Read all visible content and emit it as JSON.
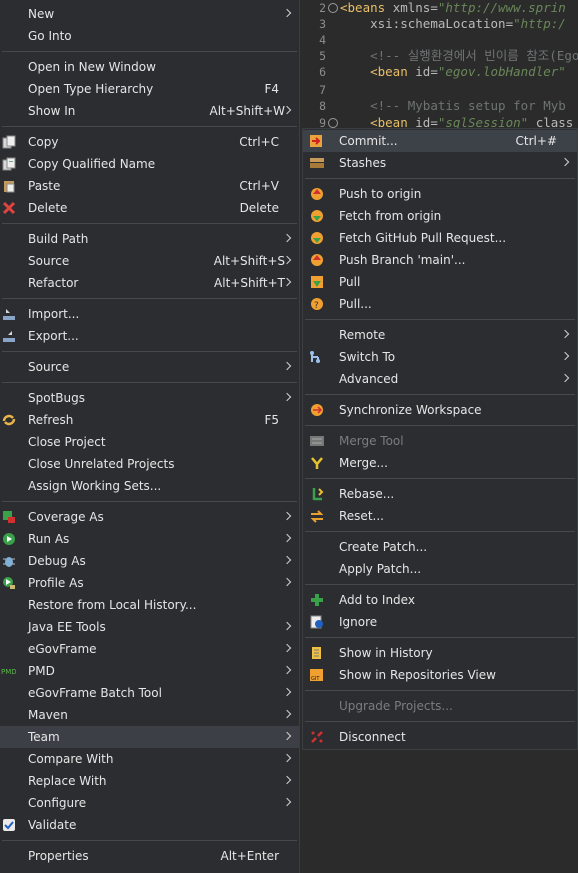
{
  "editor": {
    "lines": [
      {
        "num": "2",
        "fold": true,
        "html": "<span class='tag'>&lt;beans</span> <span class='attr'>xmlns=</span><span class='str'>\"http://www.sprin</span>"
      },
      {
        "num": "3",
        "html": "&nbsp;&nbsp;&nbsp;&nbsp;<span class='attr'>xsi:schemaLocation=</span><span class='str'>\"http:/</span>"
      },
      {
        "num": "4",
        "html": ""
      },
      {
        "num": "5",
        "html": "&nbsp;&nbsp;&nbsp;&nbsp;<span class='cmt'>&lt;!-- 실행환경에서 빈이름 참조(EgovAb</span>"
      },
      {
        "num": "6",
        "html": "&nbsp;&nbsp;&nbsp;&nbsp;<span class='tag'>&lt;bean</span> <span class='attr'>id=</span><span class='str'>\"egov.lobHandler\"</span>"
      },
      {
        "num": "7",
        "html": ""
      },
      {
        "num": "8",
        "html": "&nbsp;&nbsp;&nbsp;&nbsp;<span class='cmt'>&lt;!-- Mybatis setup for Myb</span>"
      },
      {
        "num": "9",
        "fold": true,
        "html": "&nbsp;&nbsp;&nbsp;&nbsp;<span class='tag'>&lt;bean</span> <span class='attr'>id=</span><span class='str'>\"sqlSession\"</span> <span class='attr'>class</span>"
      }
    ]
  },
  "menu": {
    "items": [
      {
        "label": "New",
        "arrow": true
      },
      {
        "label": "Go Into"
      },
      {
        "sep": true
      },
      {
        "label": "Open in New Window"
      },
      {
        "label": "Open Type Hierarchy",
        "shortcut": "F4"
      },
      {
        "label": "Show In",
        "shortcut": "Alt+Shift+W",
        "arrow": true
      },
      {
        "sep": true
      },
      {
        "label": "Copy",
        "shortcut": "Ctrl+C",
        "icon": "copy-icon"
      },
      {
        "label": "Copy Qualified Name",
        "icon": "copy-qualified-icon"
      },
      {
        "label": "Paste",
        "shortcut": "Ctrl+V",
        "icon": "paste-icon"
      },
      {
        "label": "Delete",
        "shortcut": "Delete",
        "icon": "delete-icon"
      },
      {
        "sep": true
      },
      {
        "label": "Build Path",
        "arrow": true
      },
      {
        "label": "Source",
        "shortcut": "Alt+Shift+S",
        "arrow": true
      },
      {
        "label": "Refactor",
        "shortcut": "Alt+Shift+T",
        "arrow": true
      },
      {
        "sep": true
      },
      {
        "label": "Import...",
        "icon": "import-icon"
      },
      {
        "label": "Export...",
        "icon": "export-icon"
      },
      {
        "sep": true
      },
      {
        "label": "Source",
        "arrow": true
      },
      {
        "sep": true
      },
      {
        "label": "SpotBugs",
        "arrow": true
      },
      {
        "label": "Refresh",
        "shortcut": "F5",
        "icon": "refresh-icon"
      },
      {
        "label": "Close Project"
      },
      {
        "label": "Close Unrelated Projects"
      },
      {
        "label": "Assign Working Sets..."
      },
      {
        "sep": true
      },
      {
        "label": "Coverage As",
        "arrow": true,
        "icon": "coverage-icon"
      },
      {
        "label": "Run As",
        "arrow": true,
        "icon": "run-icon"
      },
      {
        "label": "Debug As",
        "arrow": true,
        "icon": "debug-icon"
      },
      {
        "label": "Profile As",
        "arrow": true,
        "icon": "profile-icon"
      },
      {
        "label": "Restore from Local History..."
      },
      {
        "label": "Java EE Tools",
        "arrow": true
      },
      {
        "label": "eGovFrame",
        "arrow": true
      },
      {
        "label": "PMD",
        "arrow": true,
        "icon": "pmd-icon"
      },
      {
        "label": "eGovFrame Batch Tool",
        "arrow": true
      },
      {
        "label": "Maven",
        "arrow": true
      },
      {
        "label": "Team",
        "arrow": true,
        "highlight": true
      },
      {
        "label": "Compare With",
        "arrow": true
      },
      {
        "label": "Replace With",
        "arrow": true
      },
      {
        "label": "Configure",
        "arrow": true
      },
      {
        "label": "Validate",
        "icon": "checkbox-checked-icon"
      },
      {
        "sep": true
      },
      {
        "label": "Properties",
        "shortcut": "Alt+Enter"
      }
    ]
  },
  "team_menu": {
    "items": [
      {
        "label": "Commit...",
        "shortcut": "Ctrl+#",
        "icon": "commit-icon",
        "highlight": true
      },
      {
        "label": "Stashes",
        "arrow": true,
        "icon": "stashes-icon"
      },
      {
        "sep": true
      },
      {
        "label": "Push to origin",
        "icon": "push-icon"
      },
      {
        "label": "Fetch from origin",
        "icon": "fetch-icon"
      },
      {
        "label": "Fetch GitHub Pull Request...",
        "icon": "fetch-pr-icon"
      },
      {
        "label": "Push Branch 'main'...",
        "icon": "push-branch-icon"
      },
      {
        "label": "Pull",
        "icon": "pull-icon"
      },
      {
        "label": "Pull...",
        "icon": "pull-dialog-icon"
      },
      {
        "sep": true
      },
      {
        "label": "Remote",
        "arrow": true
      },
      {
        "label": "Switch To",
        "arrow": true,
        "icon": "switch-to-icon"
      },
      {
        "label": "Advanced",
        "arrow": true
      },
      {
        "sep": true
      },
      {
        "label": "Synchronize Workspace",
        "icon": "synchronize-icon"
      },
      {
        "sep": true
      },
      {
        "label": "Merge Tool",
        "icon": "merge-tool-icon",
        "disabled": true
      },
      {
        "label": "Merge...",
        "icon": "merge-icon"
      },
      {
        "sep": true
      },
      {
        "label": "Rebase...",
        "icon": "rebase-icon"
      },
      {
        "label": "Reset...",
        "icon": "reset-icon"
      },
      {
        "sep": true
      },
      {
        "label": "Create Patch..."
      },
      {
        "label": "Apply Patch..."
      },
      {
        "sep": true
      },
      {
        "label": "Add to Index",
        "icon": "add-to-index-icon"
      },
      {
        "label": "Ignore",
        "icon": "ignore-icon"
      },
      {
        "sep": true
      },
      {
        "label": "Show in History",
        "icon": "history-icon"
      },
      {
        "label": "Show in Repositories View",
        "icon": "repositories-icon"
      },
      {
        "sep": true
      },
      {
        "label": "Upgrade Projects...",
        "disabled": true
      },
      {
        "sep": true
      },
      {
        "label": "Disconnect",
        "icon": "disconnect-icon"
      }
    ]
  }
}
